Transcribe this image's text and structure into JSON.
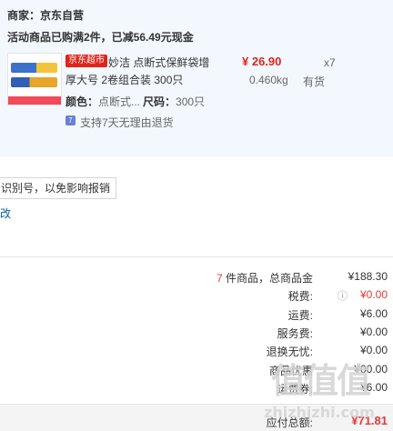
{
  "order": {
    "seller_label": "商家：京东自营",
    "promo_text": "活动商品已购满2件，已减56.49元现金",
    "item": {
      "badge": "京东超市",
      "name_line1": "妙洁 点断式保鲜袋增",
      "name_line2": "厚大号 2卷组合装 300只",
      "price": "¥ 26.90",
      "weight": "0.460kg",
      "quantity": "x7",
      "stock": "有货",
      "color_label": "颜色：",
      "color_value": "点断式...",
      "size_label": "尺码：",
      "size_value": "300只",
      "service_icon": "7",
      "service_text": "支持7天无理由退货"
    }
  },
  "invoice_notice": "识别号，以免影响报销",
  "invoice_edit_link": "改",
  "summary": {
    "items_count": "7",
    "items_label": " 件商品，总商品金",
    "items_value": "¥188.30",
    "tax_label": "税费:",
    "tax_value": "¥0.00",
    "shipping_label": "运费:",
    "shipping_value": "¥6.00",
    "service_label": "服务费:",
    "service_value": "¥0.00",
    "return_label": "退换无忧:",
    "return_value": "¥0.00",
    "promo_label": "商品优惠",
    "promo_value": "¥00.00",
    "coupon_label": "运费券:",
    "coupon_value": "-¥6.00",
    "total_label": "应付总额:",
    "total_value": "¥71.81"
  },
  "watermark": {
    "logo_text": "值值值",
    "url": "zhizhizhi.com"
  },
  "colors": {
    "accent_red": "#e2231a",
    "panel_bg": "#f3f8fe",
    "service_icon": "#6a7fd7"
  }
}
